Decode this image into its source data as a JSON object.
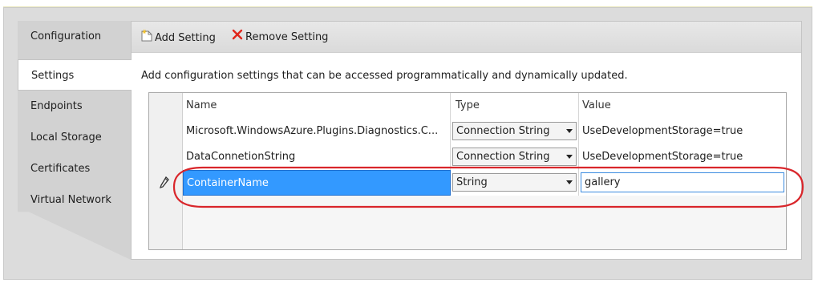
{
  "colors": {
    "accent_selection": "#3399ff",
    "remove_icon": "#e0261b",
    "highlight_ring": "#d9262b"
  },
  "sidebar": {
    "items": [
      {
        "label": "Configuration",
        "active": false
      },
      {
        "label": "Settings",
        "active": true
      },
      {
        "label": "Endpoints",
        "active": false
      },
      {
        "label": "Local Storage",
        "active": false
      },
      {
        "label": "Certificates",
        "active": false
      },
      {
        "label": "Virtual Network",
        "active": false
      }
    ]
  },
  "toolbar": {
    "add_label": "Add Setting",
    "add_icon": "new-item-icon",
    "remove_label": "Remove Setting",
    "remove_icon": "x-icon"
  },
  "description": "Add configuration settings that can be accessed programmatically and dynamically updated.",
  "table": {
    "columns": [
      "Name",
      "Type",
      "Value"
    ],
    "rows": [
      {
        "name": "Microsoft.WindowsAzure.Plugins.Diagnostics.C...",
        "type": "Connection String",
        "value": "UseDevelopmentStorage=true"
      },
      {
        "name": "DataConnetionString",
        "type": "Connection String",
        "value": "UseDevelopmentStorage=true"
      },
      {
        "name": "ContainerName",
        "type": "String",
        "value": "gallery",
        "editing": true,
        "row_icon": "pencil-icon"
      }
    ]
  }
}
